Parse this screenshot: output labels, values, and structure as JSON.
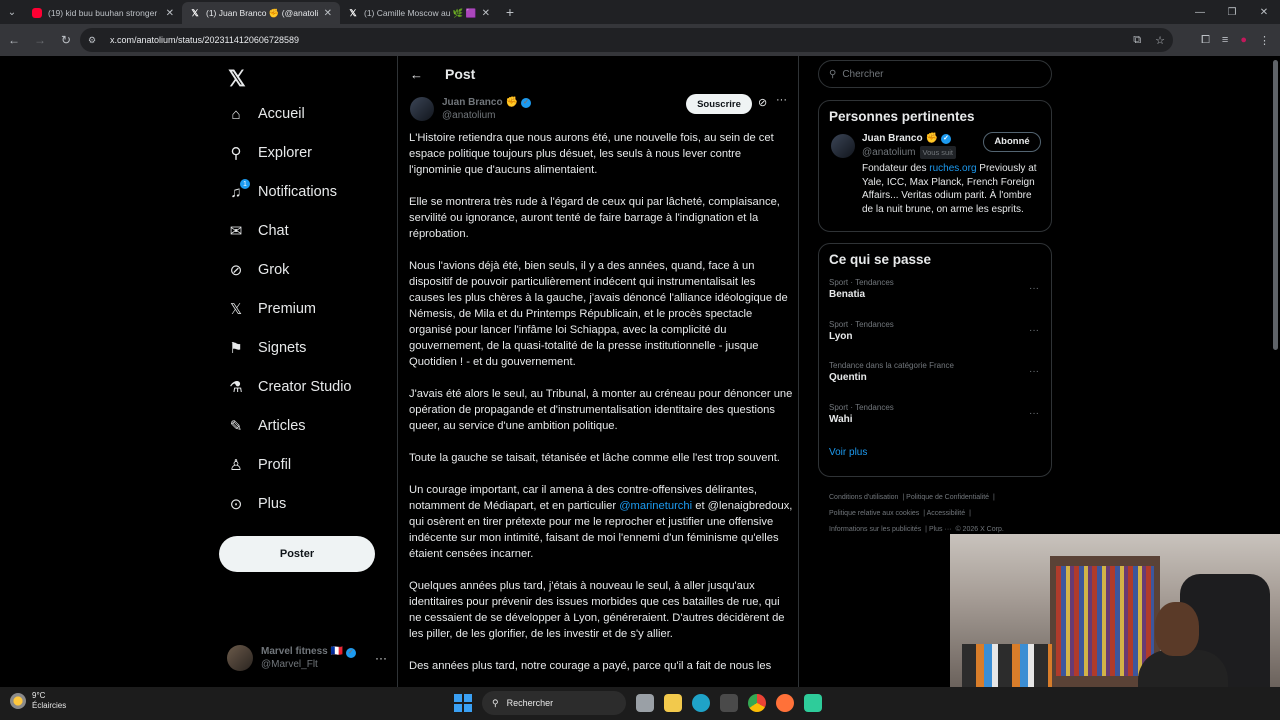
{
  "browser": {
    "tabs": [
      {
        "title": "(19) kid buu buuhan stronger -",
        "favicon": "youtube-icon",
        "active": false
      },
      {
        "title": "(1) Juan Branco ✊ (@anatoliu",
        "favicon": "x-icon",
        "active": true
      },
      {
        "title": "(1) Camille Moscow au 🌿 🟪 -",
        "favicon": "x-icon",
        "active": false
      }
    ],
    "url": "x.com/anatolium/status/2023114120606728589"
  },
  "nav": {
    "items": [
      {
        "label": "Accueil",
        "icon": "home-icon"
      },
      {
        "label": "Explorer",
        "icon": "search-icon"
      },
      {
        "label": "Notifications",
        "icon": "bell-icon",
        "badge": "1"
      },
      {
        "label": "Chat",
        "icon": "mail-icon"
      },
      {
        "label": "Grok",
        "icon": "grok-icon"
      },
      {
        "label": "Premium",
        "icon": "x-icon"
      },
      {
        "label": "Signets",
        "icon": "bookmark-icon"
      },
      {
        "label": "Creator Studio",
        "icon": "flask-icon"
      },
      {
        "label": "Articles",
        "icon": "article-icon"
      },
      {
        "label": "Profil",
        "icon": "person-icon"
      },
      {
        "label": "Plus",
        "icon": "more-circle-icon"
      }
    ],
    "post_button": "Poster",
    "account": {
      "name": "Marvel fitness",
      "flag": "🇫🇷",
      "handle": "@Marvel_Flt"
    }
  },
  "post": {
    "header": "Post",
    "author": {
      "name": "Juan Branco",
      "emoji": "✊",
      "handle": "@anatolium"
    },
    "subscribe": "Souscrire",
    "paragraphs": [
      "L'Histoire retiendra que nous aurons été, une nouvelle fois, au sein de cet espace politique toujours plus désuet, les seuls à nous lever contre l'ignominie que d'aucuns alimentaient.",
      "Elle se montrera très rude à l'égard de ceux qui par lâcheté, complaisance, servilité ou ignorance, auront tenté de faire barrage à l'indignation et la réprobation.",
      "Nous l'avions déjà été, bien seuls, il y a des années, quand, face à un dispositif de pouvoir particulièrement indécent qui instrumentalisait les causes les plus chères à la gauche, j'avais dénoncé l'alliance idéologique de Némesis, de Mila et du Printemps Républicain, et le procès spectacle organisé pour lancer l'infâme loi Schiappa, avec la complicité du gouvernement, de la quasi-totalité de la presse institutionnelle - jusque Quotidien ! - et du gouvernement.",
      "J'avais été alors le seul, au Tribunal, à monter au créneau pour dénoncer une opération de propagande et d'instrumentalisation identitaire des questions queer, au service d'une ambition politique.",
      "Toute la gauche se taisait, tétanisée et lâche comme elle l'est trop souvent."
    ],
    "p6_before": "Un courage important, car il amena à des contre-offensives délirantes, notamment de Médiapart, et en particulier ",
    "p6_mention": "@marineturchi",
    "p6_after": " et @lenaigbredoux, qui osèrent en tirer prétexte pour me le reprocher et justifier une offensive indécente sur mon intimité, faisant de moi l'ennemi d'un féminisme qu'elles étaient censées incarner.",
    "p7": "Quelques années plus tard, j'étais à nouveau le seul, à aller jusqu'aux identitaires pour prévenir des issues morbides que ces batailles de rue, qui ne cessaient de se développer à Lyon, généreraient. D'autres décidèrent de les piller, de les glorifier, de les investir et de s'y allier.",
    "p8": "Des années plus tard, notre courage a payé, parce qu'il a fait de nous les"
  },
  "sidebar": {
    "search_placeholder": "Chercher",
    "relevant": {
      "title": "Personnes pertinentes",
      "name": "Juan Branco",
      "emoji": "✊",
      "handle": "@anatolium",
      "follows_you": "Vous suit",
      "button": "Abonné",
      "bio_before": "Fondateur des ",
      "bio_link": "ruches.org",
      "bio_after": " Previously at Yale, ICC, Max Planck, French Foreign Affairs... Veritas odium parit. À l'ombre de la nuit brune, on arme les esprits."
    },
    "trends": {
      "title": "Ce qui se passe",
      "items": [
        {
          "meta": "Sport · Tendances",
          "name": "Benatia"
        },
        {
          "meta": "Sport · Tendances",
          "name": "Lyon"
        },
        {
          "meta": "Tendance dans la catégorie France",
          "name": "Quentin"
        },
        {
          "meta": "Sport · Tendances",
          "name": "Wahi"
        }
      ],
      "more": "Voir plus"
    },
    "footer": {
      "l1": "Conditions d'utilisation",
      "l2": "Politique de Confidentialité",
      "l3": "Politique relative aux cookies",
      "l4": "Accessibilité",
      "l5": "Informations sur les publicités",
      "l6": "Plus ···",
      "l7": "© 2026 X Corp."
    }
  },
  "taskbar": {
    "temp": "9°C",
    "weather": "Éclaircies",
    "search": "Rechercher"
  }
}
